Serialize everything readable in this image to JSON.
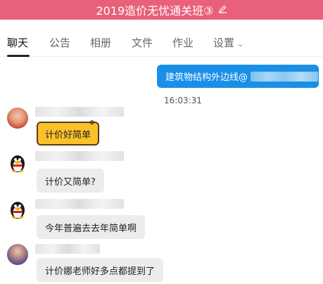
{
  "window": {
    "title": "2019造价无忧通关班③",
    "edit_icon": "pencil-icon"
  },
  "tabs": [
    {
      "label": "聊天",
      "active": true
    },
    {
      "label": "公告"
    },
    {
      "label": "相册"
    },
    {
      "label": "文件"
    },
    {
      "label": "作业"
    },
    {
      "label": "设置"
    }
  ],
  "messages": {
    "outgoing": {
      "text": "建筑物结构外边线@",
      "time": "16:03:31"
    },
    "incoming": [
      {
        "avatar": "user-photo-avatar",
        "text": "计价好简单",
        "style": "gold"
      },
      {
        "avatar": "penguin-avatar",
        "text": "计价又简单?"
      },
      {
        "avatar": "penguin-avatar",
        "text": "今年普遍去去年简单啊"
      },
      {
        "avatar": "user-photo-avatar",
        "text": "计价娜老师好多点都提到了"
      }
    ]
  },
  "colors": {
    "header": "#e8607a",
    "outgoing_bubble": "#1a8fe8",
    "incoming_bubble": "#ececec",
    "gold_bubble": "#fbc12b"
  }
}
